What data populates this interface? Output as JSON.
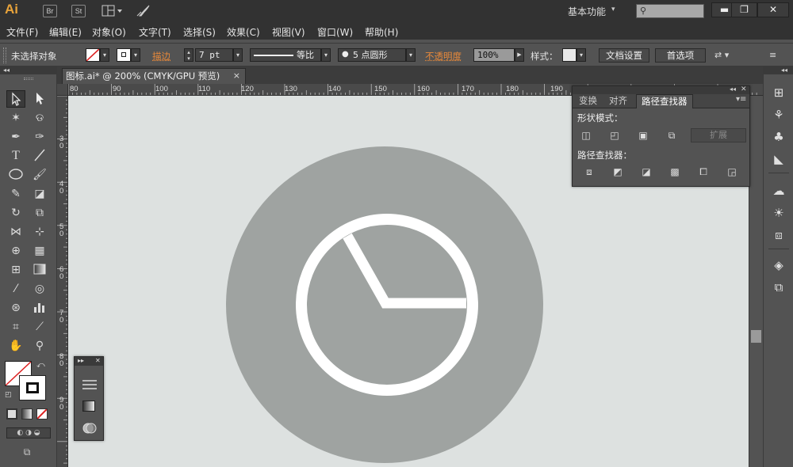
{
  "app": {
    "logo": "Ai"
  },
  "titlebar": {
    "bridge_icon": "Br",
    "stock_icon": "St",
    "arrange_icon": "arrange-documents-icon",
    "gpu_icon": "rocket-icon",
    "workspace": "基本功能",
    "search_icon": "search-icon",
    "minimize": "▬",
    "restore": "❐",
    "close": "✕"
  },
  "menubar": {
    "items": [
      "文件(F)",
      "编辑(E)",
      "对象(O)",
      "文字(T)",
      "选择(S)",
      "效果(C)",
      "视图(V)",
      "窗口(W)",
      "帮助(H)"
    ]
  },
  "controlbar": {
    "selection_status": "未选择对象",
    "stroke_label": "描边",
    "stroke_weight": "7 pt",
    "profile_label": "等比",
    "brush_label": "5 点圆形",
    "opacity_label": "不透明度",
    "opacity_value": "100%",
    "style_label": "样式：",
    "doc_setup": "文档设置",
    "preferences": "首选项"
  },
  "document": {
    "tab_title": "图标.ai* @ 200% (CMYK/GPU 预览)",
    "close": "×"
  },
  "rulers": {
    "horizontal": [
      "80",
      "90",
      "100",
      "110",
      "120",
      "130",
      "140",
      "150",
      "160",
      "170",
      "180",
      "190"
    ],
    "vertical": [
      "30",
      "40",
      "50",
      "60",
      "70",
      "80",
      "90"
    ]
  },
  "pathfinder": {
    "tabs": [
      "变换",
      "对齐",
      "路径查找器"
    ],
    "shape_modes_label": "形状模式：",
    "expand": "扩展",
    "pathfinders_label": "路径查找器："
  },
  "artwork": {
    "background_color": "#dde1e0",
    "circle_color": "#9fa3a1",
    "stroke_color": "#ffffff",
    "icon": "clock-icon"
  },
  "colors": {
    "accent_orange": "#e8893a",
    "logo_orange": "#e8a33a",
    "panel_bg": "#535353",
    "chrome_dark": "#323232"
  }
}
